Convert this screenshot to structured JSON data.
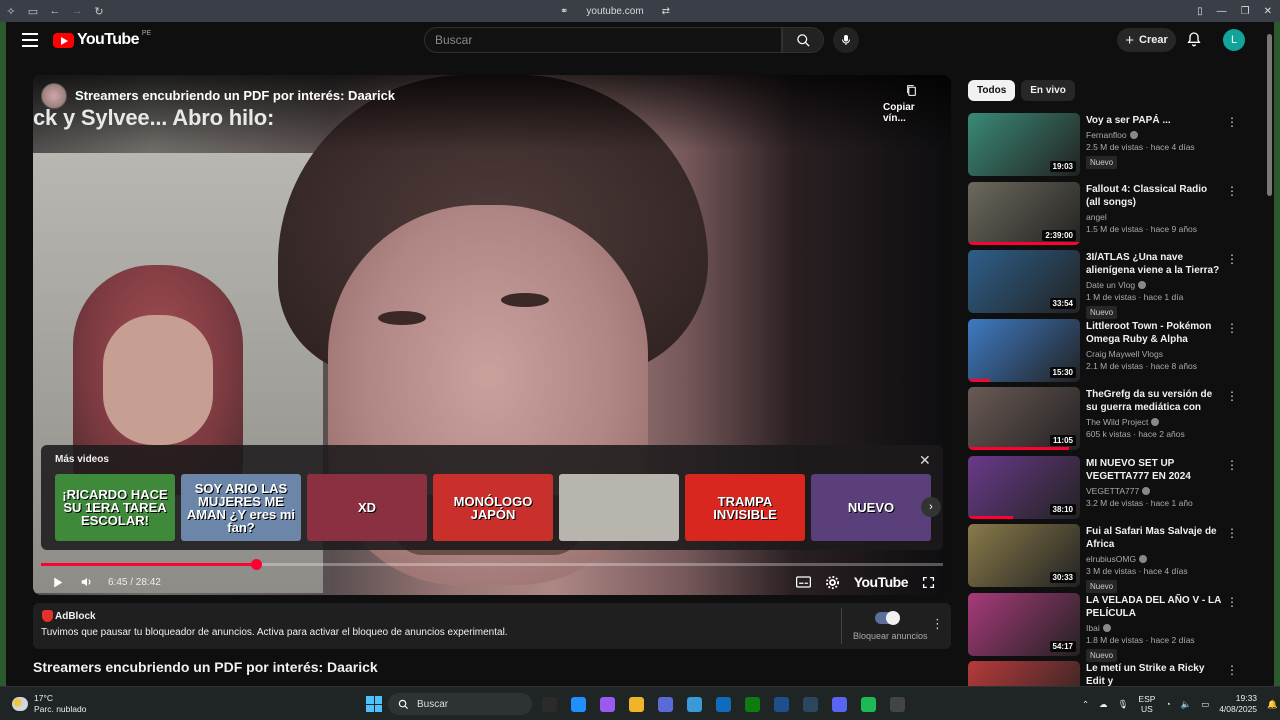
{
  "browser": {
    "url": "youtube.com"
  },
  "header": {
    "logo_text": "YouTube",
    "region": "PE",
    "search_placeholder": "Buscar",
    "create_label": "Crear",
    "avatar_letter": "L"
  },
  "player": {
    "title": "Streamers encubriendo un PDF por interés: Daarick",
    "copy_link": "Copiar vín...",
    "caption_overlay": "ck y Sylvee... Abro hilo:",
    "more_videos_title": "Más videos",
    "more_videos": [
      {
        "text": "¡RICARDO HACE SU 1ERA TAREA ESCOLAR!",
        "bg": "#3f8a3a"
      },
      {
        "text": "SOY ARIO LAS MUJERES ME AMAN ¿Y eres mi fan?",
        "bg": "#6b86a8"
      },
      {
        "text": "XD",
        "bg": "#8a3040"
      },
      {
        "text": "MONÓLOGO JAPÓN",
        "bg": "#c9302c"
      },
      {
        "text": "",
        "bg": "#b8b4ae"
      },
      {
        "text": "TRAMPA INVISIBLE",
        "bg": "#d9261f"
      },
      {
        "text": "NUEVO",
        "bg": "#5a3f7a"
      }
    ],
    "progress_percent": 23.8,
    "time_current": "6:45",
    "time_total": "28:42",
    "time_display": "6:45 / 28:42",
    "watermark": "YouTube"
  },
  "adblock": {
    "name": "AdBlock",
    "message": "Tuvimos que pausar tu bloqueador de anuncios. Activa para activar el bloqueo de anuncios experimental.",
    "toggle_label": "Bloquear anuncios"
  },
  "page_title": "Streamers encubriendo un PDF por interés: Daarick",
  "sidebar": {
    "chips": [
      {
        "label": "Todos",
        "active": true
      },
      {
        "label": "En vivo",
        "active": false
      }
    ],
    "videos": [
      {
        "title": "Voy a ser PAPÁ ...",
        "channel": "Fernanfloo",
        "verified": true,
        "meta": "2.5 M de vistas · hace 4 días",
        "badge": "Nuevo",
        "duration": "19:03",
        "thumb_bg": "#3a8a78",
        "watched": 0
      },
      {
        "title": "Fallout 4: Classical Radio (all songs)",
        "channel": "angel",
        "verified": false,
        "meta": "1.5 M de vistas · hace 9 años",
        "badge": "",
        "duration": "2:39:00",
        "thumb_bg": "#6d6a5c",
        "watched": 1.0
      },
      {
        "title": "3I/ATLAS ¿Una nave alienígena viene a la Tierra?",
        "channel": "Date un Vlog",
        "verified": true,
        "meta": "1 M de vistas · hace 1 día",
        "badge": "Nuevo",
        "duration": "33:54",
        "thumb_bg": "#2d5f8a",
        "watched": 0
      },
      {
        "title": "Littleroot Town - Pokémon Omega Ruby & Alpha Sapphire...",
        "channel": "Craig Maywell Vlogs",
        "verified": false,
        "meta": "2.1 M de vistas · hace 8 años",
        "badge": "",
        "duration": "15:30",
        "thumb_bg": "#3e7bc4",
        "watched": 0.2
      },
      {
        "title": "TheGrefg da su versión de su guerra mediática con Willyrex ...",
        "channel": "The Wild Project",
        "verified": true,
        "meta": "605 k vistas · hace 2 años",
        "badge": "",
        "duration": "11:05",
        "thumb_bg": "#6a5a55",
        "watched": 0.9
      },
      {
        "title": "MI NUEVO SET UP VEGETTA777 EN 2024",
        "channel": "VEGETTA777",
        "verified": true,
        "meta": "3.2 M de vistas · hace 1 año",
        "badge": "",
        "duration": "38:10",
        "thumb_bg": "#6a3a8a",
        "watched": 0.4
      },
      {
        "title": "Fui al Safari Mas Salvaje de Africa",
        "channel": "elrubiusOMG",
        "verified": true,
        "meta": "3 M de vistas · hace 4 días",
        "badge": "Nuevo",
        "duration": "30:33",
        "thumb_bg": "#8a7a4a",
        "watched": 0
      },
      {
        "title": "LA VELADA DEL AÑO V - LA PELÍCULA",
        "channel": "Ibai",
        "verified": true,
        "meta": "1.8 M de vistas · hace 2 días",
        "badge": "Nuevo",
        "duration": "54:17",
        "thumb_bg": "#a83a7a",
        "watched": 0
      },
      {
        "title": "Le metí un Strike a Ricky Edit y",
        "channel": "",
        "verified": false,
        "meta": "",
        "badge": "",
        "duration": "",
        "thumb_bg": "#b83a3a",
        "watched": 0
      }
    ]
  },
  "taskbar": {
    "temperature": "17°C",
    "condition": "Parc. nublado",
    "search_label": "Buscar",
    "lang_top": "ESP",
    "lang_bottom": "US",
    "time": "19:33",
    "date": "4/08/2025",
    "apps": [
      "#2b2b2b",
      "#1e90ff",
      "#9b59f0",
      "#f0b429",
      "#5b6ad6",
      "#3a9ad9",
      "#0f6cbd",
      "#107c10",
      "#1e4f8a",
      "#2a475e",
      "#5865f2",
      "#1db954",
      "#444"
    ]
  }
}
